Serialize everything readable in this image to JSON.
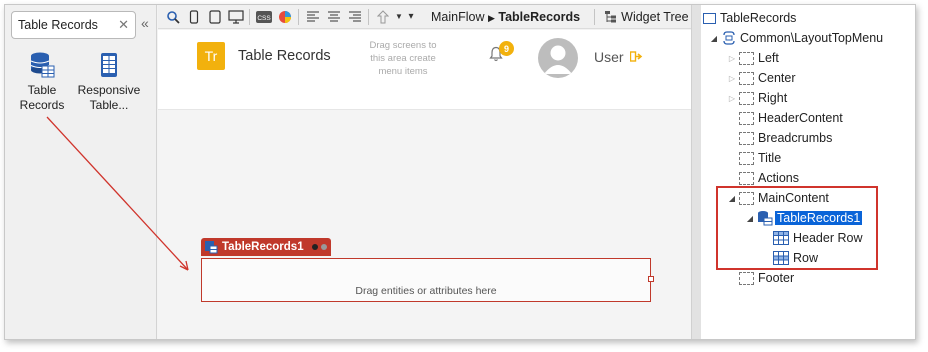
{
  "toolbox": {
    "search_value": "Table Records",
    "items": [
      {
        "label": "Table Records",
        "icon": "table-records-icon"
      },
      {
        "label": "Responsive Table...",
        "icon": "responsive-table-icon"
      }
    ]
  },
  "toolbar": {
    "breadcrumb_parent": "MainFlow",
    "breadcrumb_current": "TableRecords",
    "widget_tree_label": "Widget Tree"
  },
  "canvas": {
    "logo_text": "Tr",
    "app_title": "Table Records",
    "menu_hint": "Drag screens to this area create menu items",
    "notification_count": "9",
    "user_label": "User",
    "widget_name": "TableRecords1",
    "drop_hint": "Drag entities or attributes here"
  },
  "tree": {
    "root": "TableRecords",
    "layout": "Common\\LayoutTopMenu",
    "nodes": [
      "Left",
      "Center",
      "Right",
      "HeaderContent",
      "Breadcrumbs",
      "Title",
      "Actions",
      "MainContent"
    ],
    "table_widget": "TableRecords1",
    "children": [
      "Header Row",
      "Row"
    ],
    "footer": "Footer"
  },
  "colors": {
    "accent_red": "#c0392b",
    "logo_yellow": "#f2b10d",
    "selection_blue": "#0a64d8"
  }
}
